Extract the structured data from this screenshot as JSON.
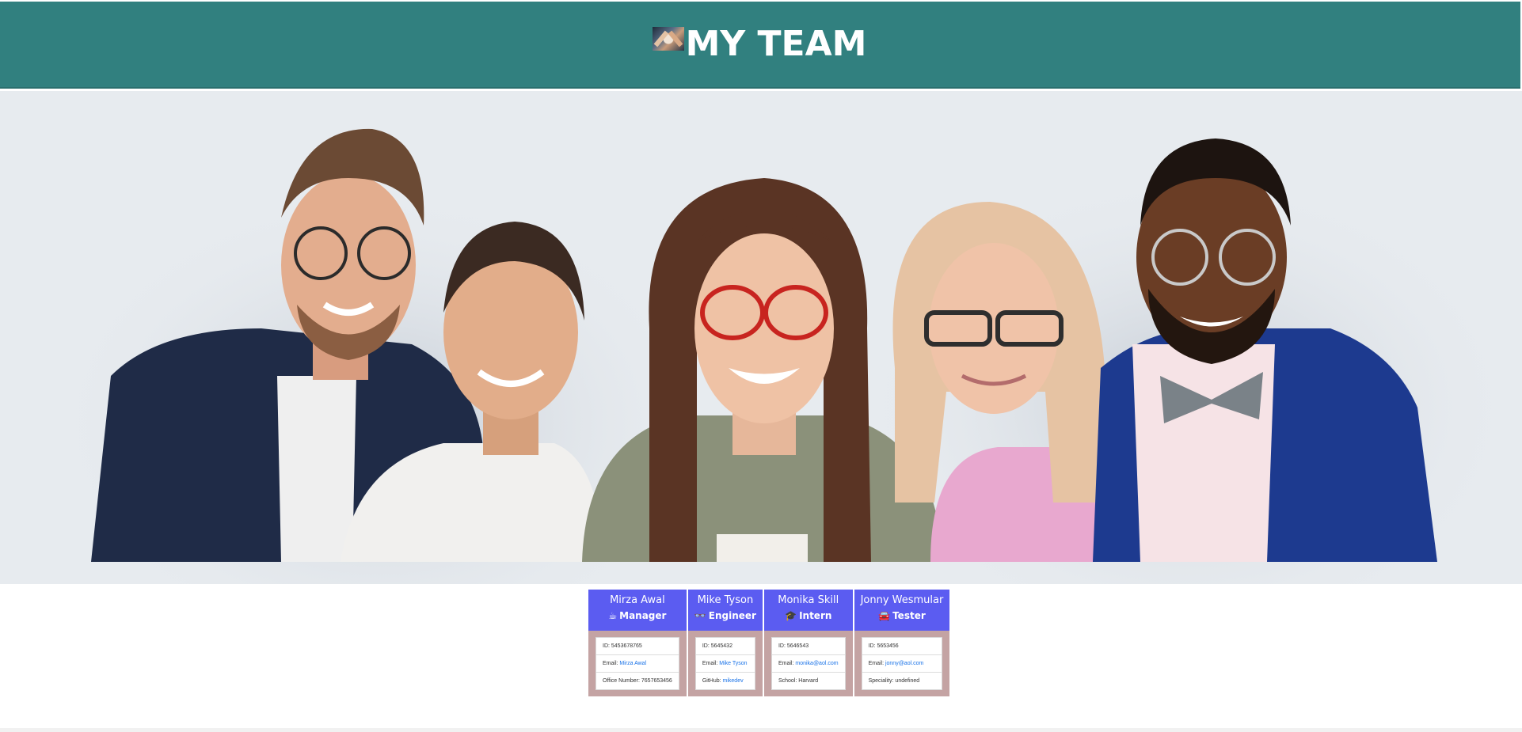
{
  "header": {
    "title": "MY TEAM",
    "background": "#31807f",
    "logo_icon": "team-photo-thumbnail"
  },
  "hero": {
    "image_description_icon": "team-group-photo",
    "background": "#e7ebef"
  },
  "cards": [
    {
      "name": "Mirza Awal",
      "role": "Manager",
      "role_icon": "☕",
      "id_label": "ID: ",
      "id_value": "5453678765",
      "email_label": "Email: ",
      "email_value": "Mirza Awal",
      "extra_label": "Office Number: ",
      "extra_value": "7657653456"
    },
    {
      "name": "Mike Tyson",
      "role": "Engineer",
      "role_icon": "👓",
      "id_label": "ID: ",
      "id_value": "5645432",
      "email_label": "Email: ",
      "email_value": "Mike Tyson",
      "extra_label": "GitHub: ",
      "extra_value": "mikedev"
    },
    {
      "name": "Monika Skill",
      "role": "Intern",
      "role_icon": "🎓",
      "id_label": "ID: ",
      "id_value": "5646543",
      "email_label": "Email: ",
      "email_value": "monika@aol.com",
      "extra_label": "School: ",
      "extra_value": "Harvard"
    },
    {
      "name": "Jonny Wesmular",
      "role": "Tester",
      "role_icon": "🚘",
      "id_label": "ID: ",
      "id_value": "5653456",
      "email_label": "Email: ",
      "email_value": "jonny@aol.com",
      "extra_label": "Speciality: ",
      "extra_value": "undefined"
    }
  ],
  "colors": {
    "card_header": "#5b5cf1",
    "card_body": "#c4a3a3",
    "link": "#1a73e8"
  }
}
